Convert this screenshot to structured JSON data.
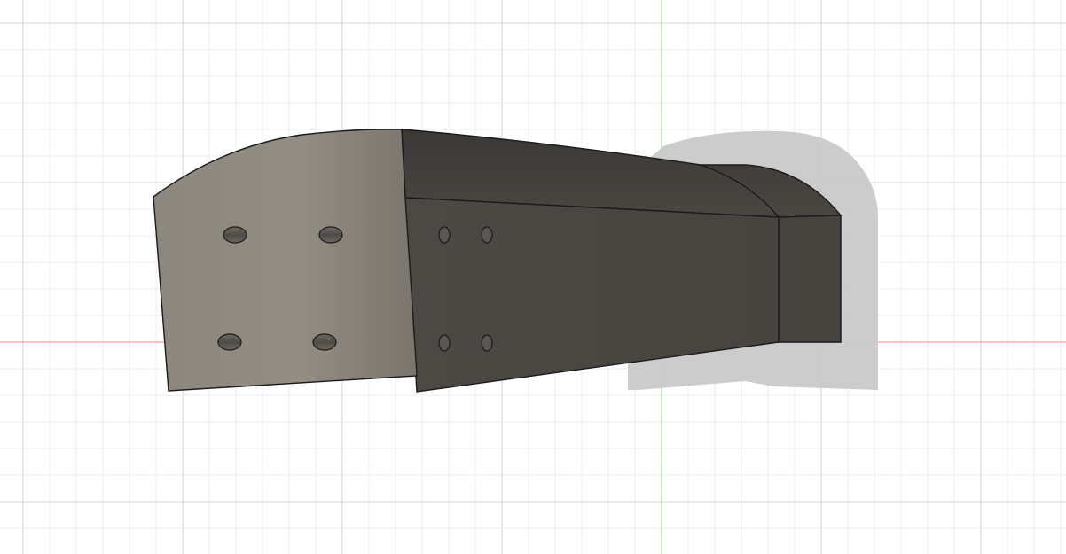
{
  "scene": {
    "background_color": "#ffffff",
    "grid": {
      "minor_color": "#ececec",
      "major_color": "#d6d6d6"
    },
    "axes": {
      "x_axis_color": "#f08a8a",
      "y_axis_color": "#86d986"
    },
    "model": {
      "outline_color": "#1a1a1a",
      "shadow_color": "#c9c9c9",
      "flange_face_light": "#9a948b",
      "flange_face_dark": "#7b766e",
      "side_face_color": "#4b4843",
      "top_face_color": "#3f3d39",
      "end_face_color": "#46443f",
      "bolt_hole_color": "#5a5751",
      "bolt_hole_count": 8
    }
  }
}
